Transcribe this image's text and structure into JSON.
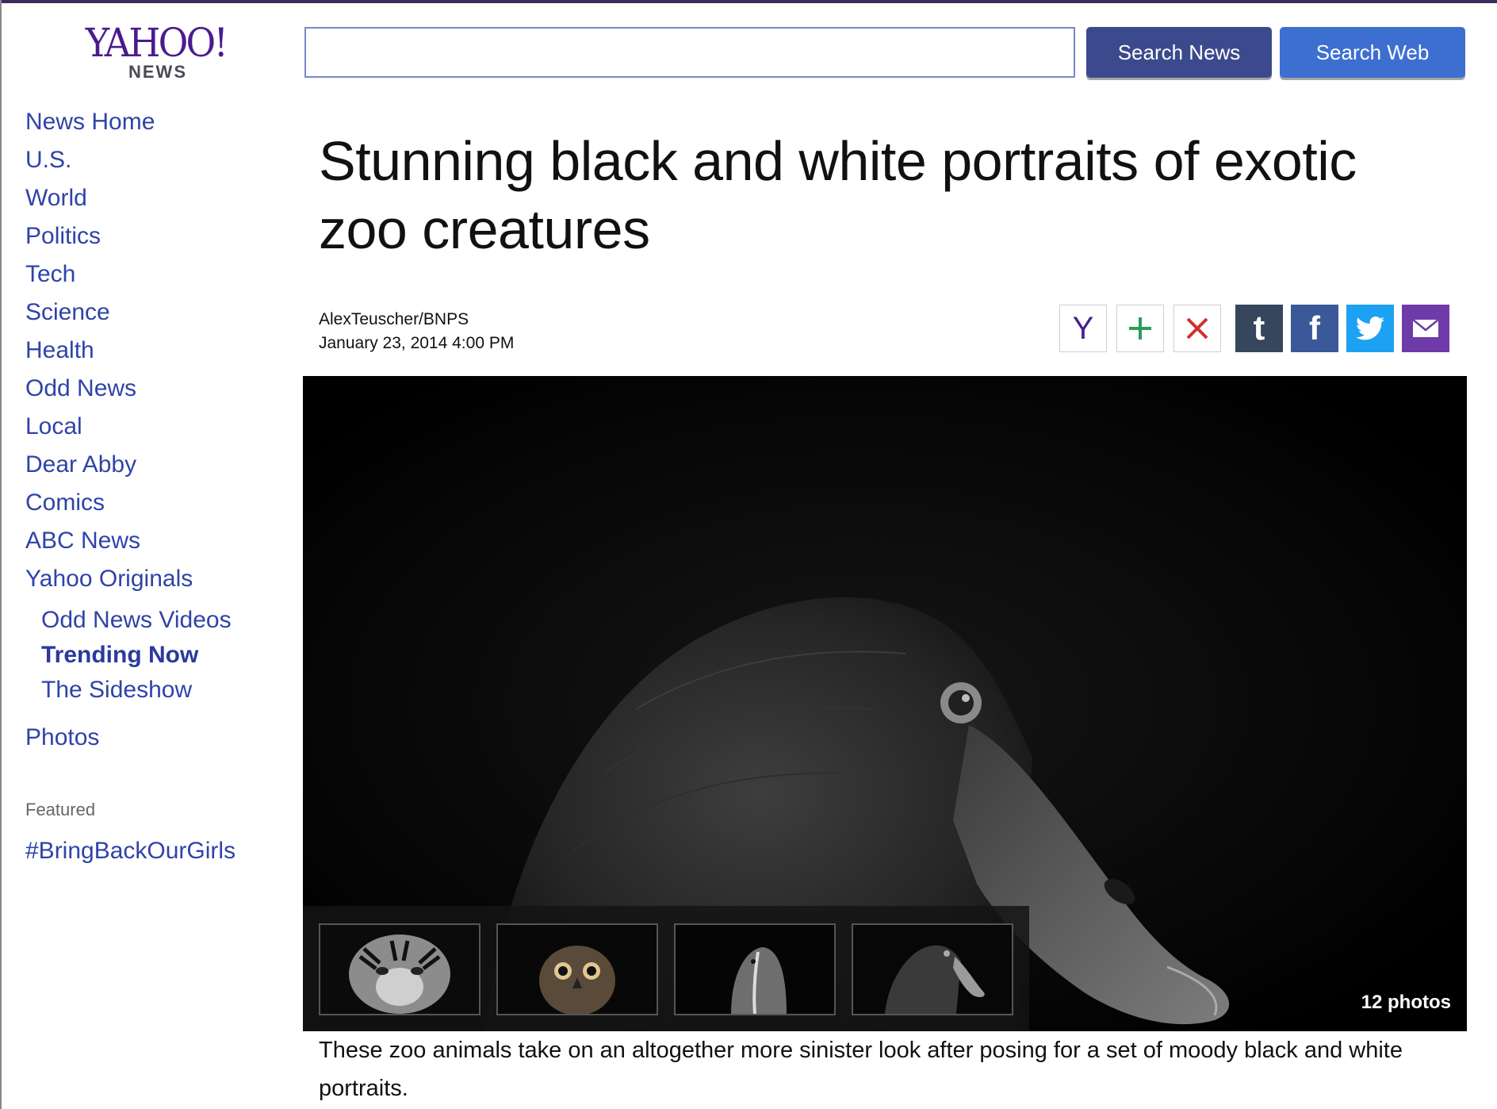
{
  "brand": {
    "logo_main": "YAHOO!",
    "logo_sub": "NEWS",
    "color": "#4b1b8e"
  },
  "search": {
    "value": "",
    "placeholder": "",
    "news_button": "Search News",
    "web_button": "Search Web"
  },
  "nav": {
    "items": [
      "News Home",
      "U.S.",
      "World",
      "Politics",
      "Tech",
      "Science",
      "Health",
      "Odd News",
      "Local",
      "Dear Abby",
      "Comics",
      "ABC News",
      "Yahoo Originals"
    ],
    "subitems": [
      "Odd News Videos",
      "Trending Now",
      "The Sideshow"
    ],
    "active_subitem": "Trending Now",
    "photos": "Photos",
    "link_color": "#2f43a8"
  },
  "featured": {
    "label": "Featured",
    "link": "#BringBackOurGirls"
  },
  "article": {
    "title": "Stunning black and white portraits of exotic zoo creatures",
    "author": "AlexTeuscher/BNPS",
    "date": "January 23, 2014 4:00 PM",
    "caption": "These zoo animals take on an altogether more sinister look after posing for a set of moody black and white portraits."
  },
  "share": {
    "icons": [
      "yahoo-y-icon",
      "plus-icon",
      "close-icon",
      "tumblr-icon",
      "facebook-icon",
      "twitter-icon",
      "mail-icon"
    ],
    "yahoo_glyph": "Y",
    "plus_glyph": "+",
    "tumblr_glyph": "t",
    "facebook_glyph": "f",
    "colors": {
      "tumblr": "#36465d",
      "facebook": "#3b5998",
      "twitter": "#1da1f2",
      "mail": "#6f3ba8",
      "close": "#d0312d",
      "plus": "#2a9d5c",
      "yahoo": "#4b1b8e"
    }
  },
  "gallery": {
    "count_label": "12 photos",
    "thumbnails": [
      "tiger",
      "owl",
      "bird",
      "swan"
    ]
  }
}
